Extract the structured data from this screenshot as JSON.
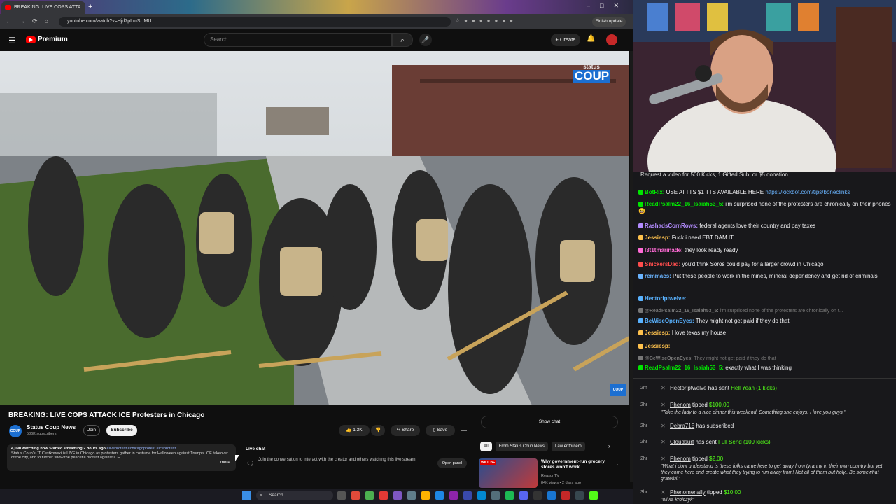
{
  "browser": {
    "tab_title": "BREAKING: LIVE COPS ATTA",
    "url": "youtube.com/watch?v=Hjd7pLmSUMU",
    "finish_update": "Finish update"
  },
  "youtube": {
    "logo_text": "Premium",
    "search_placeholder": "Search",
    "create_label": "Create",
    "watermark_top": "status",
    "watermark_main": "COUP",
    "video_title": "BREAKING: LIVE COPS ATTACK ICE Protesters in Chicago",
    "channel_name": "Status Coup News",
    "subscriber_count": "536K subscribers",
    "join_label": "Join",
    "subscribe_label": "Subscribe",
    "like_count": "1.3K",
    "share_label": "Share",
    "save_label": "Save",
    "description_meta": "4,090 watching now  Started streaming 2 hours ago",
    "description_tags": "#liveprotest #chicagoprotest #iceprotest",
    "description_text": "Status Coup's JT Cestkowski is LIVE in Chicago as protesters gather in costume for Halloween against Trump's ICE takeover of the city, and to further show the peaceful protest against ICE",
    "description_more": "...more",
    "live_chat_title": "Live chat",
    "live_chat_text": "Join the conversation to interact with the creator and others watching this live stream.",
    "open_panel": "Open panel",
    "show_chat": "Show chat",
    "chips": [
      "All",
      "From Status Coup News",
      "Law enforcem"
    ],
    "rec_title": "Why government-run grocery stores won't work",
    "rec_channel": "ReasonTV",
    "rec_meta": "84K views • 2 days ago",
    "rec_badge": "WILL BE"
  },
  "taskbar": {
    "search_placeholder": "Search"
  },
  "chat": {
    "header": "Request a video for 500 Kicks, 1 Gifted Sub, or $5 donation.",
    "messages": [
      {
        "user": "BotRix:",
        "color": "#00e600",
        "text": "USE AI TTS $1 TTS AVAILABLE HERE ",
        "link": "https://kickbot.com/tips/boneclinks"
      },
      {
        "user": "ReadPsalm22_16_Isaiah53_5:",
        "color": "#00e600",
        "text": "i'm surprised none of the protesters are chronically on their phones 😆"
      },
      {
        "user": "RashadsCornRows:",
        "color": "#b38cff",
        "text": "federal agents love their country and pay taxes"
      },
      {
        "user": "Jessiesp:",
        "color": "#ffc24d",
        "text": "Fuck i need EBT DAM IT"
      },
      {
        "user": "l3t1tmarinade:",
        "color": "#ff6bd6",
        "text": "they look ready ready"
      },
      {
        "user": "SnickersDad:",
        "color": "#ff4d4d",
        "text": "you'd think Soros could pay for a larger crowd in Chicago"
      },
      {
        "user": "remmacs:",
        "color": "#6ab4ff",
        "text": "Put these people to work in the mines, mineral dependency and get rid of criminals"
      },
      {
        "user": "Hectoriptwelve:",
        "color": "#59b2ff",
        "text": ""
      },
      {
        "user": "@ReadPsalm22_16_Isaiah53_5:",
        "color": "#777777",
        "text": "i'm surprised none of the protesters are chronically on t..."
      },
      {
        "user": "BeWiseOpenEyes:",
        "color": "#59b2ff",
        "text": "They might not get paid if they do that"
      },
      {
        "user": "Jessiesp:",
        "color": "#ffc24d",
        "text": "I love texas my house"
      },
      {
        "user": "Jessiesp:",
        "color": "#ffc24d",
        "text": ""
      },
      {
        "user": "@BeWiseOpenEyes:",
        "color": "#777777",
        "text": "They might not get paid if they do that"
      },
      {
        "user": "ReadPsalm22_16_Isaiah53_5:",
        "color": "#00e600",
        "text": "exactly what I was thinking"
      }
    ],
    "events": [
      {
        "time": "2m",
        "name": "Hectoriptwelve",
        "action": "has sent ",
        "detail": "Hell Yeah (1 kicks)",
        "quote": ""
      },
      {
        "time": "2hr",
        "name": "Phenom",
        "action": "tipped ",
        "detail": "$100.00",
        "quote": "\"Take the lady to a nice dinner this weekend. Something she enjoys. I love you guys.\""
      },
      {
        "time": "2hr",
        "name": "Debra715",
        "action": "has subscribed",
        "detail": "",
        "quote": ""
      },
      {
        "time": "2hr",
        "name": "Cloudsurf",
        "action": "has sent ",
        "detail": "Full Send (100 kicks)",
        "quote": ""
      },
      {
        "time": "2hr",
        "name": "Phenom",
        "action": "tipped ",
        "detail": "$2.00",
        "quote": "\"What i dont understand is these folks came here to get away from tyranny in their own country but yet they come here and create what they trying to run away from! Not all of them but holy.. Be somewhat grateful.\""
      },
      {
        "time": "3hr",
        "name": "Phenomenally",
        "action": "tipped ",
        "detail": "$10.00",
        "quote": "\"olivia kroiczyk\""
      }
    ]
  }
}
